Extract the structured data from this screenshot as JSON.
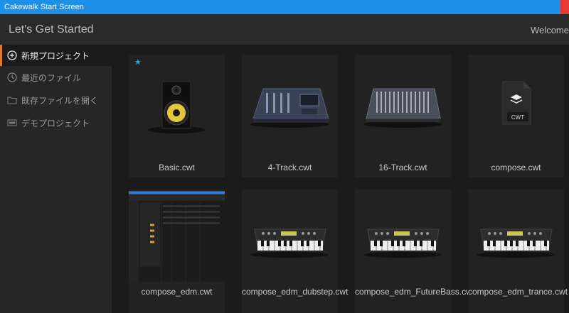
{
  "window": {
    "title": "Cakewalk Start Screen"
  },
  "header": {
    "heading": "Let's Get Started",
    "welcome": "Welcome"
  },
  "sidebar": {
    "items": [
      {
        "label": "新規プロジェクト",
        "icon": "plus-circle-icon",
        "active": true
      },
      {
        "label": "最近のファイル",
        "icon": "clock-icon",
        "active": false
      },
      {
        "label": "既存ファイルを開く",
        "icon": "folder-icon",
        "active": false
      },
      {
        "label": "デモプロジェクト",
        "icon": "demo-icon",
        "active": false
      }
    ]
  },
  "templates": [
    {
      "label": "Basic.cwt",
      "thumb": "speaker",
      "starred": true
    },
    {
      "label": "4-Track.cwt",
      "thumb": "mixer-small"
    },
    {
      "label": "16-Track.cwt",
      "thumb": "mixer-large"
    },
    {
      "label": "compose.cwt",
      "thumb": "cwt-file",
      "badge": "CWT"
    },
    {
      "label": "compose_edm.cwt",
      "thumb": "daw-screenshot"
    },
    {
      "label": "compose_edm_dubstep.cwt",
      "thumb": "synth"
    },
    {
      "label": "compose_edm_FutureBass.cwt",
      "thumb": "synth"
    },
    {
      "label": "compose_edm_trance.cwt",
      "thumb": "synth"
    }
  ],
  "colors": {
    "accent": "#e07a2a",
    "titlebar": "#1e90e8",
    "star": "#2aa3e6"
  }
}
